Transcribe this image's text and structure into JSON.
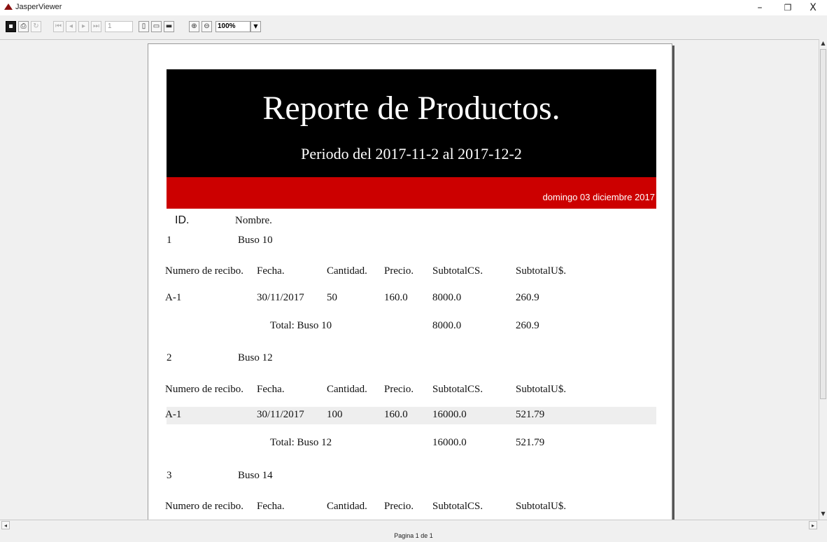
{
  "window": {
    "title": "JasperViewer",
    "minimize": "–",
    "restore": "❐",
    "close": "X"
  },
  "toolbar": {
    "page_number": "1",
    "zoom": "100%"
  },
  "report": {
    "title": "Reporte de Productos.",
    "period": "Periodo del 2017-11-2  al  2017-12-2",
    "date": "domingo 03 diciembre 2017",
    "col_id": "ID.",
    "col_name": "Nombre.",
    "detail_headers": [
      "Numero de recibo.",
      "Fecha.",
      "Cantidad.",
      "Precio.",
      "SubtotalCS.",
      "SubtotalU$."
    ],
    "groups": [
      {
        "id": "1",
        "name": "Buso 10",
        "row": {
          "recibo": "A-1",
          "fecha": "30/11/2017",
          "cantidad": "50",
          "precio": "160.0",
          "subcs": "8000.0",
          "subus": "260.9"
        },
        "total_label": "Total: Buso 10",
        "total_cs": "8000.0",
        "total_us": "260.9"
      },
      {
        "id": "2",
        "name": "Buso 12",
        "row": {
          "recibo": "A-1",
          "fecha": "30/11/2017",
          "cantidad": "100",
          "precio": "160.0",
          "subcs": "16000.0",
          "subus": "521.79"
        },
        "total_label": "Total: Buso 12",
        "total_cs": "16000.0",
        "total_us": "521.79"
      },
      {
        "id": "3",
        "name": "Buso 14"
      }
    ]
  },
  "status": {
    "text": "Pagina 1 de 1"
  },
  "icons": [
    "save-icon",
    "print-icon",
    "reload-icon",
    "first-page-icon",
    "prev-page-icon",
    "next-page-icon",
    "last-page-icon",
    "actual-size-icon",
    "fit-page-icon",
    "fit-width-icon",
    "zoom-in-icon",
    "zoom-out-icon",
    "dropdown-icon"
  ]
}
